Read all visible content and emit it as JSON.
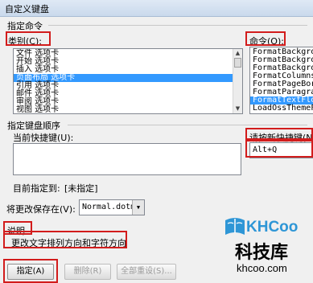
{
  "dialog": {
    "title": "自定义键盘"
  },
  "commands_group": {
    "label": "指定命令"
  },
  "categories": {
    "label": "类别(C):",
    "items": [
      "文件 选项卡",
      "开始 选项卡",
      "插入 选项卡",
      "页面布局 选项卡",
      "引用 选项卡",
      "邮件 选项卡",
      "审阅 选项卡",
      "视图 选项卡"
    ],
    "selected_index": 3
  },
  "commands": {
    "label": "命令(O):",
    "items": [
      "FormatBackgroun",
      "FormatBackgroun",
      "FormatBackgroun",
      "FormatColumns",
      "FormatPageBorde",
      "FormatParagraph",
      "FormatTextFlow",
      "LoadOssThemeFro"
    ],
    "selected_index": 6
  },
  "key_group": {
    "label": "指定键盘顺序"
  },
  "current_keys": {
    "label": "当前快捷键(U):",
    "value": ""
  },
  "new_key": {
    "label": "请按新快捷键(N):",
    "value": "Alt+Q"
  },
  "currently_assigned": {
    "label": "目前指定到:",
    "value": "[未指定]"
  },
  "save_changes": {
    "label": "将更改保存在(V):",
    "value": "Normal.dotm"
  },
  "description": {
    "label": "说明",
    "text": "更改文字排列方向和字符方向"
  },
  "buttons": {
    "assign": "指定(A)",
    "remove": "删除(R)",
    "reset_all": "全部重设(S)..."
  },
  "watermark": {
    "logo": "KHCoo",
    "name": "科技库",
    "url": "khcoo.com"
  }
}
